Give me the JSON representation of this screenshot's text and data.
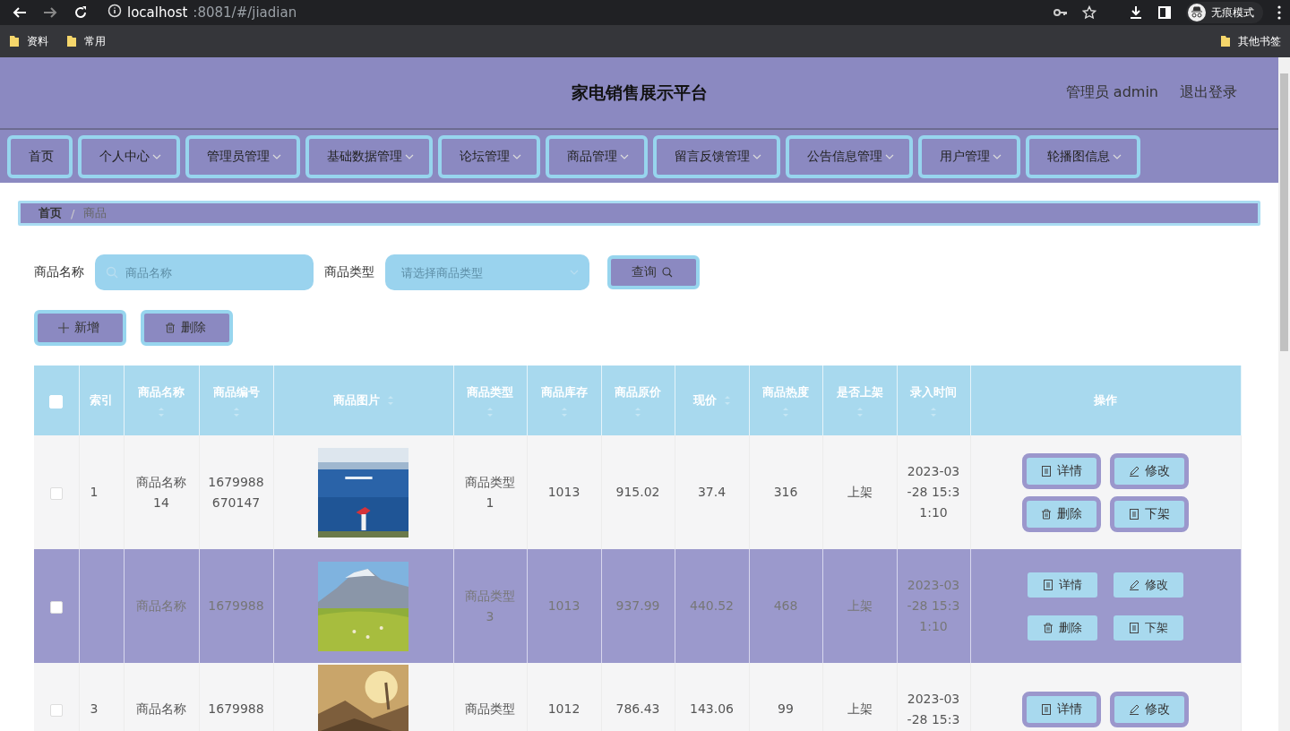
{
  "browser": {
    "url_host": "localhost",
    "url_rest": ":8081/#/jiadian",
    "profile_label": "无痕模式",
    "bookmarks": [
      {
        "label": "资料"
      },
      {
        "label": "常用"
      }
    ],
    "other_bookmarks": "其他书签"
  },
  "header": {
    "title": "家电销售展示平台",
    "user": "管理员 admin",
    "logout": "退出登录"
  },
  "nav": [
    {
      "label": "首页",
      "dropdown": false
    },
    {
      "label": "个人中心",
      "dropdown": true
    },
    {
      "label": "管理员管理",
      "dropdown": true
    },
    {
      "label": "基础数据管理",
      "dropdown": true
    },
    {
      "label": "论坛管理",
      "dropdown": true
    },
    {
      "label": "商品管理",
      "dropdown": true
    },
    {
      "label": "留言反馈管理",
      "dropdown": true
    },
    {
      "label": "公告信息管理",
      "dropdown": true
    },
    {
      "label": "用户管理",
      "dropdown": true
    },
    {
      "label": "轮播图信息",
      "dropdown": true
    }
  ],
  "breadcrumb": {
    "home": "首页",
    "separator": "/",
    "current": "商品"
  },
  "filters": [
    {
      "kind": "input",
      "label": "商品名称",
      "placeholder": "商品名称"
    },
    {
      "kind": "select",
      "label": "商品类型",
      "placeholder": "请选择商品类型"
    }
  ],
  "query_button": "查询",
  "actions": [
    {
      "kind": "add",
      "label": "新增"
    },
    {
      "kind": "delete",
      "label": "删除"
    }
  ],
  "table": {
    "select_all": {
      "checked": false
    },
    "columns": [
      {
        "label": "索引",
        "sortable": false
      },
      {
        "label": "商品名称",
        "sortable": true,
        "sort_inline": false
      },
      {
        "label": "商品编号",
        "sortable": true,
        "sort_inline": false
      },
      {
        "label": "商品图片",
        "sortable": true,
        "sort_inline": true
      },
      {
        "label": "商品类型",
        "sortable": true,
        "sort_inline": false
      },
      {
        "label": "商品库存",
        "sortable": true,
        "sort_inline": false
      },
      {
        "label": "商品原价",
        "sortable": true,
        "sort_inline": false
      },
      {
        "label": "现价",
        "sortable": true,
        "sort_inline": true
      },
      {
        "label": "商品热度",
        "sortable": true,
        "sort_inline": false
      },
      {
        "label": "是否上架",
        "sortable": true,
        "sort_inline": false
      },
      {
        "label": "录入时间",
        "sortable": true,
        "sort_inline": false
      },
      {
        "label": "操作",
        "sortable": false
      }
    ],
    "rows": [
      {
        "checked": false,
        "hovered": false,
        "cells": [
          "1",
          "商品名称\n14",
          "1679988\n670147",
          {
            "kind": "picture"
          },
          "商品类型\n1",
          "1013",
          "915.02",
          "37.4",
          "316",
          "上架",
          "2023-03\n-28 15:3\n1:10"
        ],
        "buttons": [
          {
            "kind": "detail",
            "label": "详情"
          },
          {
            "kind": "edit",
            "label": "修改"
          },
          {
            "kind": "delete",
            "label": "删除"
          },
          {
            "kind": "unshelve",
            "label": "下架"
          }
        ]
      },
      {
        "checked": false,
        "hovered": true,
        "cells": [
          "",
          "商品名称",
          "1679988",
          {
            "kind": "picture"
          },
          "商品类型\n3",
          "1013",
          "937.99",
          "440.52",
          "468",
          "上架",
          "2023-03\n-28 15:3\n1:10"
        ],
        "buttons": [
          {
            "kind": "detail",
            "label": "详情"
          },
          {
            "kind": "edit",
            "label": "修改"
          },
          {
            "kind": "delete",
            "label": "删除"
          },
          {
            "kind": "unshelve",
            "label": "下架"
          }
        ]
      },
      {
        "checked": false,
        "hovered": false,
        "cells": [
          "3",
          "商品名称",
          "1679988",
          {
            "kind": "picture"
          },
          "商品类型",
          "1012",
          "786.43",
          "143.06",
          "99",
          "上架",
          "2023-03\n-28 15:3"
        ],
        "buttons": [
          {
            "kind": "detail",
            "label": "详情"
          },
          {
            "kind": "edit",
            "label": "修改"
          }
        ]
      }
    ]
  }
}
